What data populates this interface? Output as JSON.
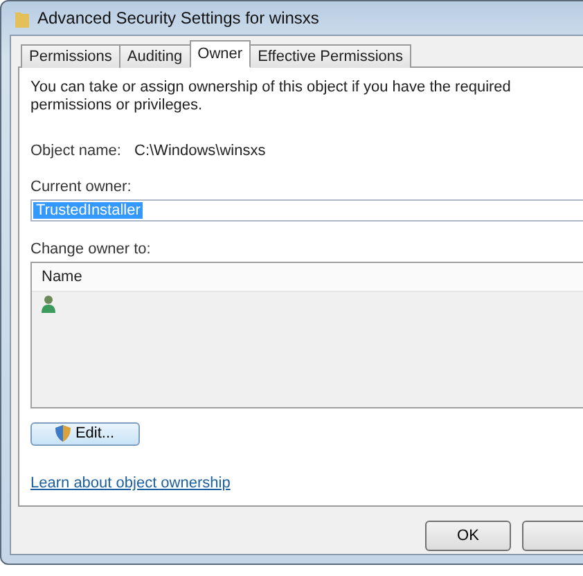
{
  "window": {
    "title": "Advanced Security Settings for winsxs"
  },
  "tabs": [
    {
      "label": "Permissions",
      "selected": false
    },
    {
      "label": "Auditing",
      "selected": false
    },
    {
      "label": "Owner",
      "selected": true
    },
    {
      "label": "Effective Permissions",
      "selected": false
    }
  ],
  "intro": "You can take or assign ownership of this object if you have the required permissions or privileges.",
  "object_name": {
    "label": "Object name:",
    "value": "C:\\Windows\\winsxs"
  },
  "current_owner": {
    "label": "Current owner:",
    "value": "TrustedInstaller"
  },
  "change_owner": {
    "label": "Change owner to:",
    "columns": [
      "Name"
    ],
    "rows": [
      {
        "kind": "user"
      }
    ]
  },
  "edit_button": "Edit...",
  "link": "Learn about object ownership",
  "buttons": [
    "OK"
  ]
}
